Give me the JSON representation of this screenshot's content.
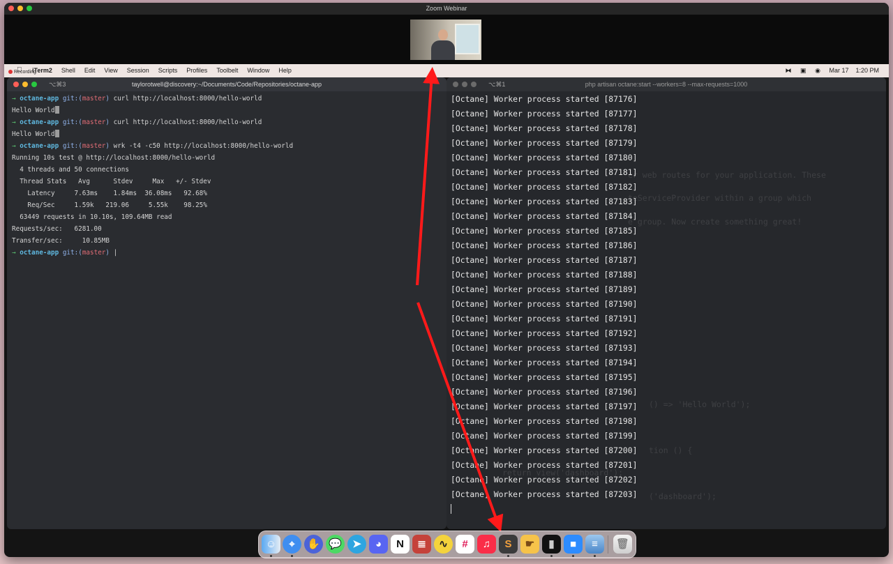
{
  "zoom": {
    "title": "Zoom Webinar",
    "recording": "Recording"
  },
  "menubar": {
    "apple_icon": "",
    "items": [
      "iTerm2",
      "Shell",
      "Edit",
      "View",
      "Session",
      "Scripts",
      "Profiles",
      "Toolbelt",
      "Window",
      "Help"
    ],
    "date": "Mar 17",
    "time": "1:20 PM"
  },
  "left_terminal": {
    "shortcut": "⌥⌘3",
    "title": "taylorotwell@discovery:~/Documents/Code/Repositories/octane-app",
    "prompt_arrow": "→",
    "prompt_dir": "octane-app",
    "prompt_git": "git:(",
    "prompt_branch": "master",
    "prompt_close": ")",
    "cmd1": " curl http://localhost:8000/hello-world",
    "out1": "Hello World",
    "cmd2": " curl http://localhost:8000/hello-world",
    "out2": "Hello World",
    "cmd3": " wrk -t4 -c50 http://localhost:8000/hello-world",
    "stats": [
      "Running 10s test @ http://localhost:8000/hello-world",
      "  4 threads and 50 connections",
      "  Thread Stats   Avg      Stdev     Max   +/- Stdev",
      "    Latency     7.63ms    1.84ms  36.08ms   92.68%",
      "    Req/Sec     1.59k   219.06     5.55k    98.25%",
      "  63449 requests in 10.10s, 109.64MB read",
      "Requests/sec:   6281.00",
      "Transfer/sec:     10.85MB"
    ],
    "cursor": "|"
  },
  "right_terminal": {
    "shortcut": "⌥⌘1",
    "title": "php artisan octane:start --workers=8 --max-requests=1000",
    "lines": [
      "[Octane] Worker process started [87176]",
      "[Octane] Worker process started [87177]",
      "[Octane] Worker process started [87178]",
      "[Octane] Worker process started [87179]",
      "[Octane] Worker process started [87180]",
      "[Octane] Worker process started [87181]",
      "[Octane] Worker process started [87182]",
      "[Octane] Worker process started [87183]",
      "[Octane] Worker process started [87184]",
      "[Octane] Worker process started [87185]",
      "[Octane] Worker process started [87186]",
      "[Octane] Worker process started [87187]",
      "[Octane] Worker process started [87188]",
      "[Octane] Worker process started [87189]",
      "[Octane] Worker process started [87190]",
      "[Octane] Worker process started [87191]",
      "[Octane] Worker process started [87192]",
      "[Octane] Worker process started [87193]",
      "[Octane] Worker process started [87194]",
      "[Octane] Worker process started [87195]",
      "[Octane] Worker process started [87196]",
      "[Octane] Worker process started [87197]",
      "[Octane] Worker process started [87198]",
      "[Octane] Worker process started [87199]",
      "[Octane] Worker process started [87200]",
      "[Octane] Worker process started [87201]",
      "[Octane] Worker process started [87202]",
      "[Octane] Worker process started [87203]"
    ],
    "ghost_lines": [
      "er web routes for your application. These",
      "teServiceProvider within a group which",
      "e group. Now create something great!",
      "() => 'Hello World');",
      "tion () {",
      "return view('dashboard');",
      "('dashboard');"
    ]
  },
  "colors": {
    "arrow": "#ff1a1a",
    "prompt_green": "#5cc873",
    "dir_cyan": "#5fb8e0",
    "branch_red": "#e06c75"
  },
  "dock": {
    "icons": [
      "finder-icon",
      "safari-icon",
      "hand-icon",
      "messages-icon",
      "telegram-icon",
      "discord-icon",
      "notion-icon",
      "stack-icon",
      "activity-icon",
      "slack-icon",
      "music-icon",
      "sublime-icon",
      "hand-app-icon",
      "terminal-icon",
      "zoom-icon",
      "database-icon",
      "trash-icon"
    ]
  }
}
